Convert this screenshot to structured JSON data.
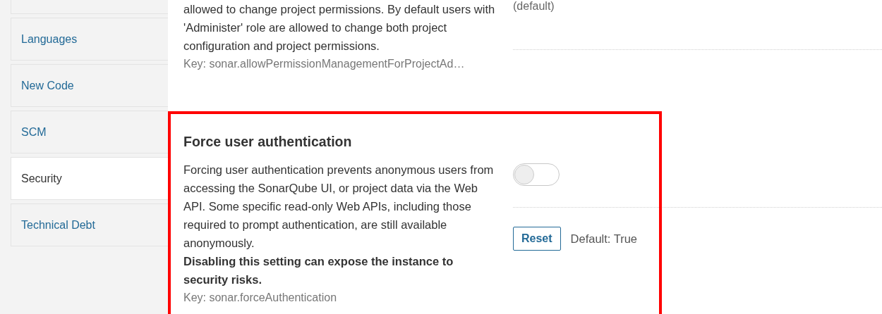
{
  "sidebar": {
    "items": [
      {
        "label": "Languages",
        "selected": false
      },
      {
        "label": "New Code",
        "selected": false
      },
      {
        "label": "SCM",
        "selected": false
      },
      {
        "label": "Security",
        "selected": true
      },
      {
        "label": "Technical Debt",
        "selected": false
      }
    ]
  },
  "settings": [
    {
      "description": "allowed to change project permissions. By default users with 'Administer' role are allowed to change both project configuration and project permissions.",
      "key": "Key: sonar.allowPermissionManagementForProjectAd…",
      "default_note": "(default)",
      "highlighted": false
    },
    {
      "title": "Force user authentication",
      "description": "Forcing user authentication prevents anonymous users from accessing the SonarQube UI, or project data via the Web API. Some specific read-only Web APIs, including those required to prompt authentication, are still available anonymously.",
      "warning": "Disabling this setting can expose the instance to security risks.",
      "key": "Key: sonar.forceAuthentication",
      "toggle": {
        "on": false
      },
      "reset_button": "Reset",
      "default_value": "Default: True",
      "highlighted": true
    }
  ]
}
